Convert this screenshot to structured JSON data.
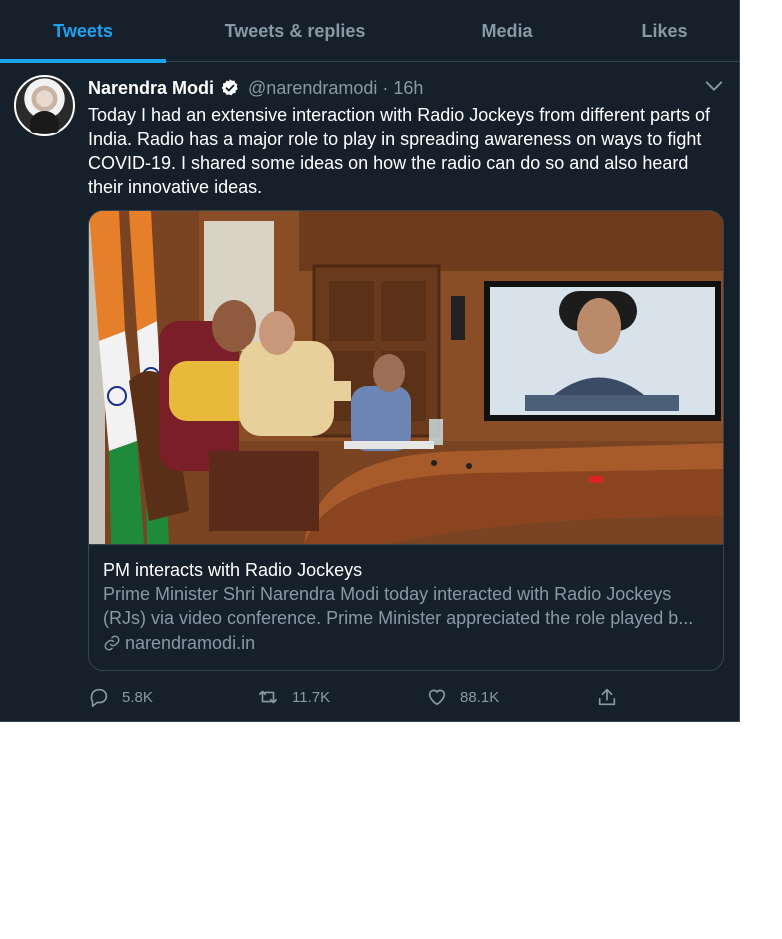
{
  "tabs": [
    {
      "label": "Tweets",
      "active": true
    },
    {
      "label": "Tweets & replies",
      "active": false
    },
    {
      "label": "Media",
      "active": false
    },
    {
      "label": "Likes",
      "active": false
    }
  ],
  "tweet": {
    "author_name": "Narendra Modi",
    "handle": "@narendramodi",
    "separator": "·",
    "time": "16h",
    "text": "Today I had an extensive interaction with Radio Jockeys from different parts of India. Radio has a major role to play in spreading awareness on ways to fight COVID-19. I shared some ideas on how the radio can do so and also heard their innovative ideas.",
    "card": {
      "title": "PM interacts with Radio Jockeys",
      "description_line1": "Prime Minister Shri Narendra Modi today interacted with Radio Jockeys",
      "description_line2": "(RJs) via video conference. Prime Minister appreciated the role played b...",
      "domain": "narendramodi.in"
    },
    "actions": {
      "replies": "5.8K",
      "retweets": "11.7K",
      "likes": "88.1K"
    }
  },
  "colors": {
    "background": "#15202b",
    "accent": "#1da1f2",
    "muted": "#8899a6",
    "border": "#38444d"
  },
  "icons": [
    "verified-badge-icon",
    "chevron-down-icon",
    "link-icon",
    "reply-icon",
    "retweet-icon",
    "like-icon",
    "share-icon"
  ]
}
